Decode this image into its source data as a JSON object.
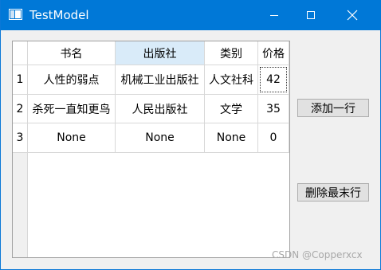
{
  "window": {
    "title": "TestModel",
    "controls": {
      "minimize": "minimize-icon",
      "maximize": "maximize-icon",
      "close": "close-icon"
    }
  },
  "table": {
    "columns": [
      "书名",
      "出版社",
      "类别",
      "价格"
    ],
    "selected_column": "出版社",
    "row_headers": [
      "1",
      "2",
      "3"
    ],
    "rows": [
      [
        "人性的弱点",
        "机械工业出版社",
        "人文社科",
        "42"
      ],
      [
        "杀死一直知更鸟",
        "人民出版社",
        "文学",
        "35"
      ],
      [
        "None",
        "None",
        "None",
        "0"
      ]
    ],
    "focused_cell": "42"
  },
  "buttons": {
    "add_row": "添加一行",
    "delete_last_row": "删除最末行"
  },
  "watermark": "CSDN @Copperxcx",
  "colors": {
    "titlebar": "#0078d7",
    "selected_header": "#d9ebf9",
    "window_background": "#f0f0f0"
  }
}
